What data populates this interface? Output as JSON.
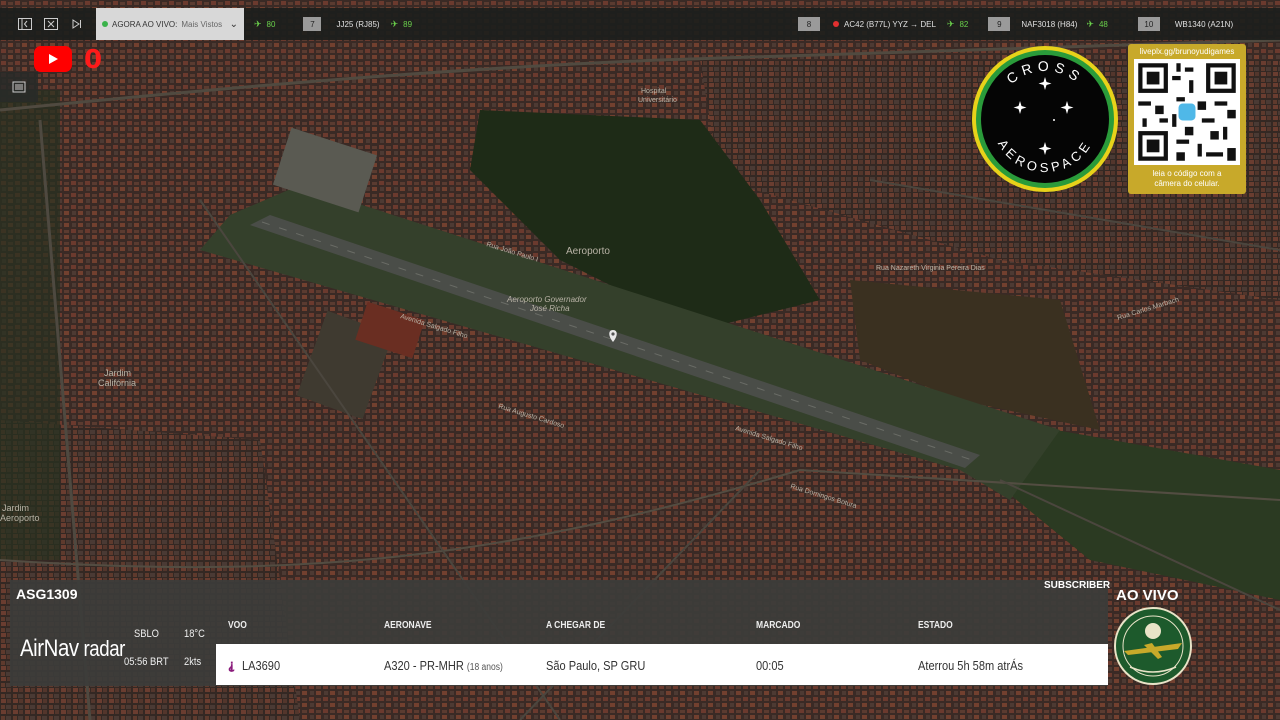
{
  "topbar": {
    "live_label": "AGORA AO VIVO:",
    "live_value": "Mais Vistos",
    "tickers": [
      {
        "num": "",
        "text": "80"
      },
      {
        "num": "7",
        "text": "JJ25 (RJ85)",
        "count": "89"
      },
      {
        "num": "8",
        "text": "AC42 (B77L)  YYZ → DEL",
        "count": "82"
      },
      {
        "num": "9",
        "text": "NAF3018 (H84)",
        "count": "48"
      },
      {
        "num": "10",
        "text": "WB1340 (A21N)",
        "count": ""
      }
    ]
  },
  "youtube": {
    "count": "0"
  },
  "map": {
    "labels": {
      "aeroporto": "Aeroporto",
      "airport_name_1": "Aeroporto Governador",
      "airport_name_2": "José Richa",
      "hospital_1": "Hospital",
      "hospital_2": "Universitário",
      "jardim_california_1": "Jardim",
      "jardim_california_2": "Califórnia",
      "jardim_aeroporto_1": "Jardim",
      "jardim_aeroporto_2": "Aeroporto",
      "street_1": "Avenida Salgado Filho",
      "street_2": "Rua João Paulo I",
      "street_3": "Rua Augusto Cardoso",
      "street_4": "Avenida Salgado Filho",
      "street_5": "Rua Nazareth Virginia Pereira Dias",
      "street_6": "Rua Carlos Marbach",
      "street_7": "Rua Domingos Botura"
    }
  },
  "logo": {
    "top_text": "CROSS",
    "bottom_text": "AEROSPACE"
  },
  "qr": {
    "url": "liveplx.gg/brunoyudigames",
    "caption_1": "leia o código com a",
    "caption_2": "câmera do celular."
  },
  "flight": {
    "callsign": "ASG1309",
    "subscriber": "SUBSCRIBER",
    "brand_1": "AirNav",
    "brand_2": "radar",
    "airport": "SBLO",
    "temp": "18°C",
    "time": "05:56 BRT",
    "wind": "2kts",
    "headers": {
      "voo": "VOO",
      "aeronave": "AERONAVE",
      "origem": "A CHEGAR DE",
      "marcado": "MARCADO",
      "estado": "ESTADO"
    },
    "row": {
      "voo": "LA3690",
      "aeronave": "A320 - PR-MHR",
      "idade": "(18 anos)",
      "origem": "São Paulo, SP GRU",
      "marcado": "00:05",
      "estado": "Aterrou 5h 58m atrÁs"
    }
  },
  "aovivo": "AO VIVO",
  "colors": {
    "accent_green": "#6bd04b",
    "youtube_red": "#ff0000",
    "logo_ring": "#2a9b3a",
    "qr_gold": "#c8a92a"
  }
}
